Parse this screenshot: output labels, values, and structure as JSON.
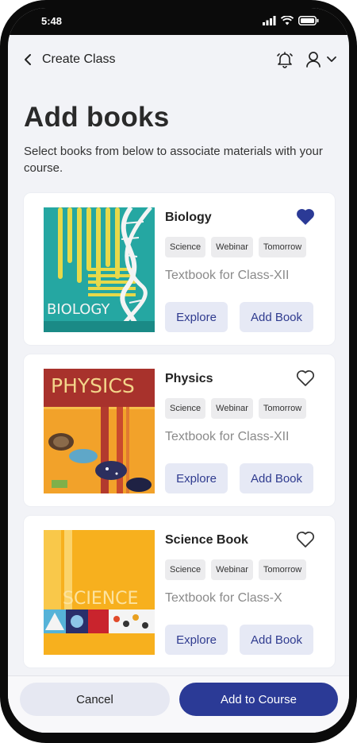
{
  "status_bar": {
    "time": "5:48",
    "icons": [
      "signal-icon",
      "wifi-icon",
      "battery-icon"
    ]
  },
  "header": {
    "title": "Create Class",
    "icons": [
      "back-icon",
      "bell-icon",
      "user-icon",
      "caret-down-icon"
    ]
  },
  "page": {
    "heading": "Add books",
    "subtitle": "Select books from below to associate materials with your course."
  },
  "books": [
    {
      "title": "Biology",
      "favorited": true,
      "tags": [
        "Science",
        "Webinar",
        "Tomorrow"
      ],
      "subtitle": "Textbook for Class-XII",
      "cover_text": "BIOLOGY",
      "explore_label": "Explore",
      "add_label": "Add Book"
    },
    {
      "title": "Physics",
      "favorited": false,
      "tags": [
        "Science",
        "Webinar",
        "Tomorrow"
      ],
      "subtitle": "Textbook for Class-XII",
      "cover_text": "PHYSICS",
      "explore_label": "Explore",
      "add_label": "Add Book"
    },
    {
      "title": "Science Book",
      "favorited": false,
      "tags": [
        "Science",
        "Webinar",
        "Tomorrow"
      ],
      "subtitle": "Textbook for Class-X",
      "cover_text": "SCIENCE",
      "explore_label": "Explore",
      "add_label": "Add Book"
    }
  ],
  "footer": {
    "cancel_label": "Cancel",
    "add_label": "Add to Course"
  },
  "colors": {
    "accent": "#2b3a96",
    "button_bg": "#e6e9f5",
    "favorite": "#2b3a96"
  }
}
